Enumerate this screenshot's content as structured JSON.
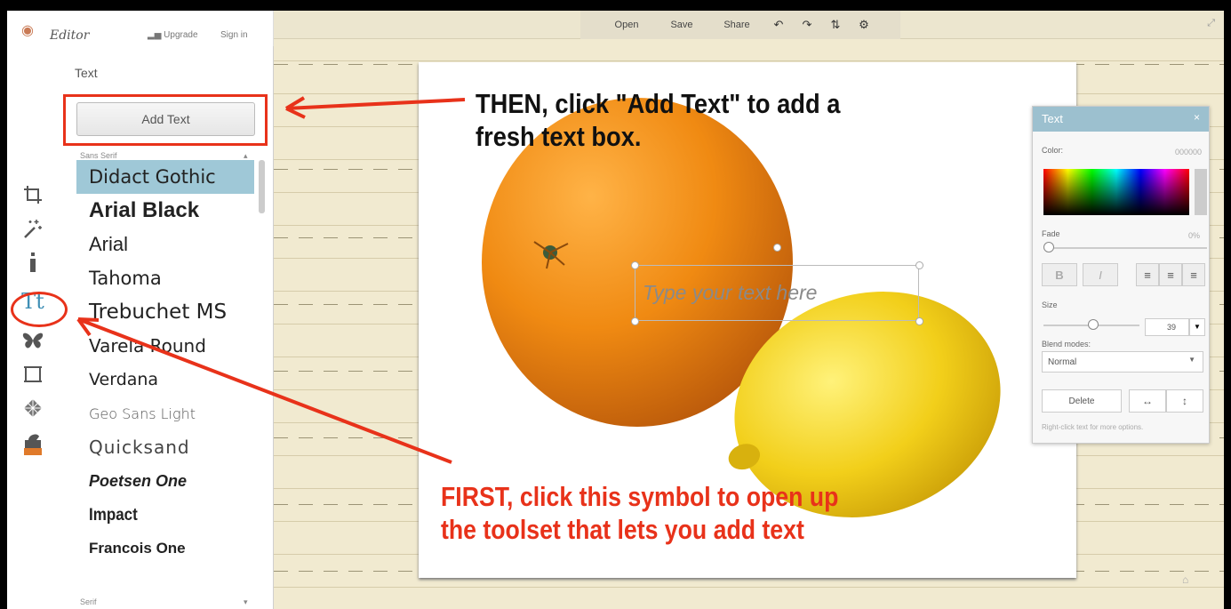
{
  "app": {
    "logo_text": "Editor",
    "upgrade": "Upgrade",
    "sign_in": "Sign in"
  },
  "toolbar": {
    "open": "Open",
    "save": "Save",
    "share": "Share",
    "undo_icon": "↶",
    "redo_icon": "↷",
    "compare_icon": "⇅",
    "settings_icon": "⚙",
    "resize_icon": "⤢"
  },
  "sidebar": {
    "tools": [
      "crop-icon",
      "effects-wand-icon",
      "touch-up-brush-icon",
      "text-tt-icon",
      "overlay-butterfly-icon",
      "frame-icon",
      "texture-icon",
      "seasonal-icon"
    ]
  },
  "text_panel": {
    "title": "Text",
    "add_text_button": "Add Text",
    "category_sans": "Sans Serif",
    "category_serif": "Serif",
    "fonts": [
      "Didact Gothic",
      "Arial Black",
      "Arial",
      "Tahoma",
      "Trebuchet MS",
      "Varela Round",
      "Verdana",
      "Geo Sans Light",
      "Quicksand",
      "Poetsen One",
      "Impact",
      "Francois One"
    ],
    "selected_font": "Didact Gothic"
  },
  "canvas": {
    "text_placeholder": "Type your text here"
  },
  "text_props": {
    "title": "Text",
    "close": "×",
    "color_label": "Color:",
    "color_value": "000000",
    "fade_label": "Fade",
    "fade_value": "0%",
    "bold": "B",
    "italic": "I",
    "size_label": "Size",
    "size_value": "39",
    "blend_label": "Blend modes:",
    "blend_value": "Normal",
    "delete_button": "Delete",
    "flip_h": "↔",
    "flip_v": "↕",
    "hint": "Right-click text for more options."
  },
  "annotations": {
    "then_line1": "THEN, click \"Add Text\" to add a",
    "then_line2": "fresh text box.",
    "first_line1": "FIRST, click this symbol to open up",
    "first_line2": "the toolset that lets you add text",
    "color": "#e8321a"
  }
}
